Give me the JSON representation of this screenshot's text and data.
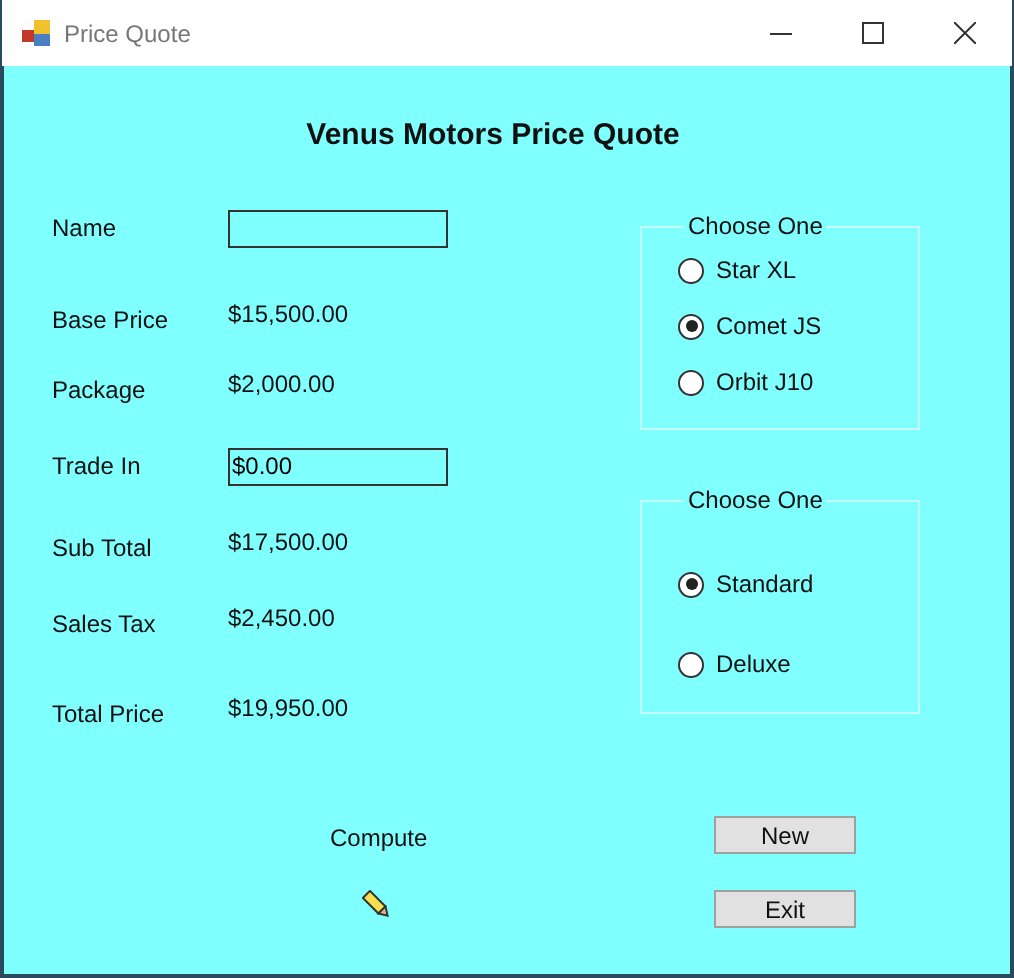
{
  "window": {
    "title": "Price Quote"
  },
  "heading": "Venus Motors Price Quote",
  "fields": [
    {
      "label": "Name",
      "kind": "textbox"
    },
    {
      "label": "Base Price",
      "kind": "output",
      "value": "$15,500.00"
    },
    {
      "label": "Package",
      "kind": "output",
      "value": "$2,000.00"
    },
    {
      "label": "Trade In",
      "kind": "textbox",
      "value": "$0.00"
    },
    {
      "label": "Sub Total",
      "kind": "output",
      "value": "$17,500.00"
    },
    {
      "label": "Sales Tax",
      "kind": "output",
      "value": "$2,450.00"
    },
    {
      "label": "Total Price",
      "kind": "output",
      "value": "$19,950.00"
    }
  ],
  "groups": [
    {
      "legend": "Choose One",
      "options": [
        {
          "label": "Star XL",
          "selected": false
        },
        {
          "label": "Comet JS",
          "selected": true
        },
        {
          "label": "Orbit J10",
          "selected": false
        }
      ]
    },
    {
      "legend": "Choose One",
      "options": [
        {
          "label": "Standard",
          "selected": true
        },
        {
          "label": "Deluxe",
          "selected": false
        }
      ]
    }
  ],
  "compute": "Compute",
  "buttons": [
    "New",
    "Exit"
  ]
}
